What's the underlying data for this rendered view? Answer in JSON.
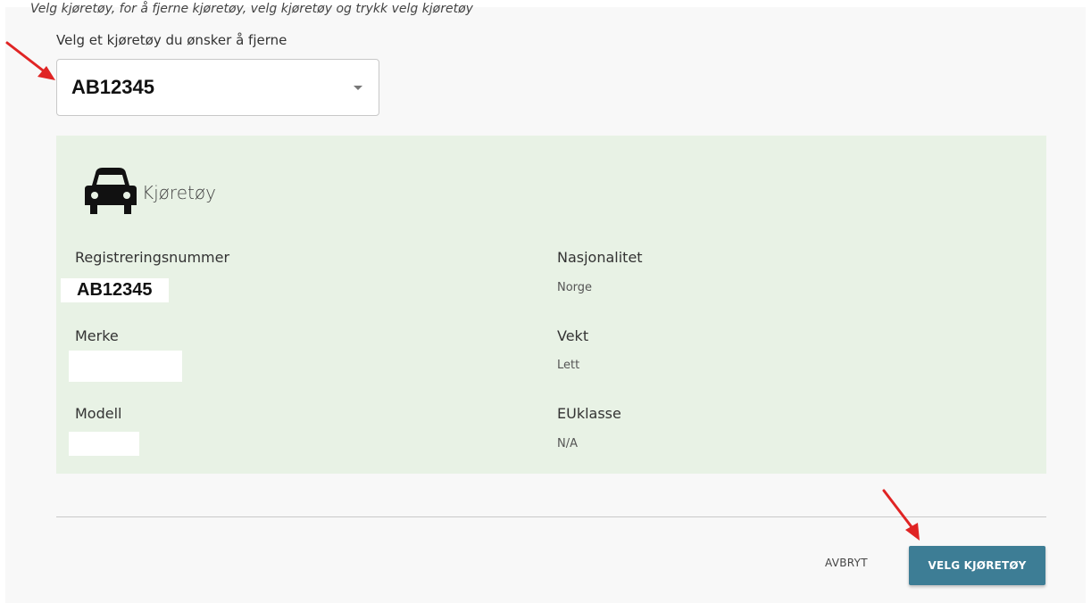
{
  "header": {
    "italic_text": "Velg kjøretøy, for å fjerne kjøretøy, velg kjøretøy og trykk velg kjøretøy"
  },
  "select": {
    "label": "Velg et kjøretøy du ønsker å fjerne",
    "value": "AB12345"
  },
  "vehicle_card": {
    "title": "Kjøretøy",
    "icon": "car-icon",
    "background": "#e8f2e5",
    "fields": {
      "registreringsnummer": {
        "label": "Registreringsnummer",
        "value": "AB12345"
      },
      "merke": {
        "label": "Merke",
        "value": ""
      },
      "modell": {
        "label": "Modell",
        "value": ""
      },
      "nasjonalitet": {
        "label": "Nasjonalitet",
        "value": "Norge"
      },
      "vekt": {
        "label": "Vekt",
        "value": "Lett"
      },
      "euklasse": {
        "label": "EUklasse",
        "value": "N/A"
      }
    }
  },
  "actions": {
    "cancel_label": "AVBRYT",
    "confirm_label": "VELG KJØRETØY",
    "confirm_color": "#3d7d95"
  },
  "annotation_color": "#e02424"
}
